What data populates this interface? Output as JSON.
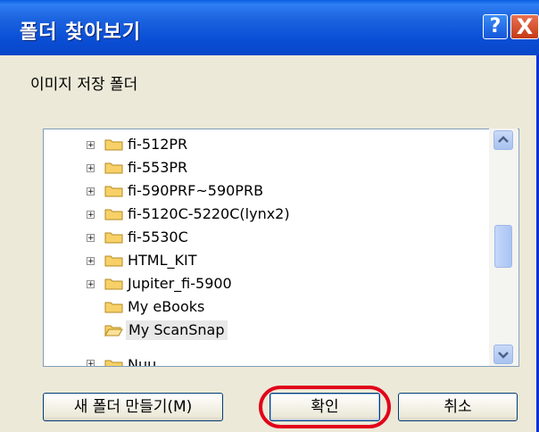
{
  "window": {
    "title": "폴더 찾아보기",
    "help_label": "?",
    "close_label": "X"
  },
  "prompt": "이미지 저장 폴더",
  "tree": {
    "items": [
      {
        "label": "fi-512PR",
        "expandable": true
      },
      {
        "label": "fi-553PR",
        "expandable": true
      },
      {
        "label": "fi-590PRF~590PRB",
        "expandable": true
      },
      {
        "label": "fi-5120C-5220C(lynx2)",
        "expandable": true
      },
      {
        "label": "fi-5530C",
        "expandable": true
      },
      {
        "label": "HTML_KIT",
        "expandable": true
      },
      {
        "label": "Jupiter_fi-5900",
        "expandable": true
      },
      {
        "label": "My eBooks",
        "expandable": false
      },
      {
        "label": "My ScanSnap",
        "expandable": false,
        "selected": true
      },
      {
        "label": "Nuu",
        "expandable": true
      }
    ]
  },
  "buttons": {
    "new_folder": "새 폴더 만들기(M)",
    "ok": "확인",
    "cancel": "취소"
  },
  "colors": {
    "titlebar": "#0a4fd6",
    "highlight_ring": "#e2001a",
    "folder": "#f7d168"
  }
}
